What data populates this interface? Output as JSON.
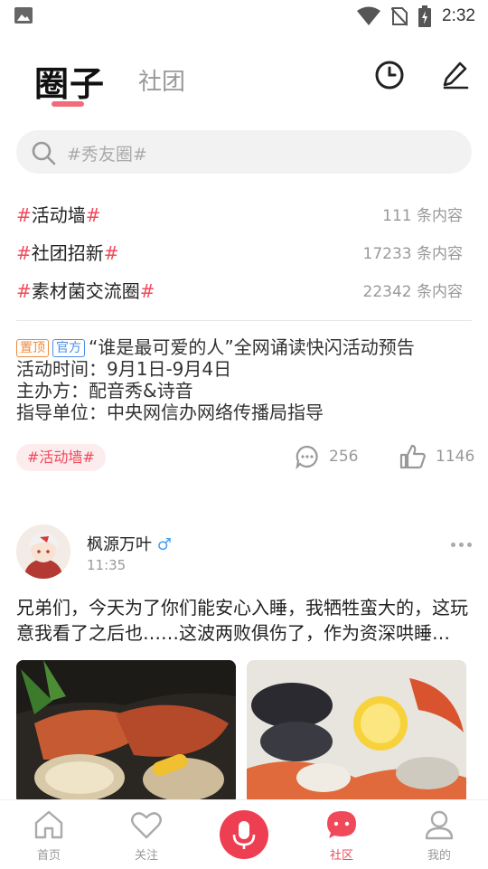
{
  "status_bar": {
    "time": "2:32"
  },
  "header": {
    "tab_active": "圈子",
    "tab_inactive": "社团"
  },
  "search": {
    "placeholder": "#秀友圈#"
  },
  "topics": [
    {
      "name": "活动墙",
      "count": "111 条内容"
    },
    {
      "name": "社团招新",
      "count": "17233 条内容"
    },
    {
      "name": "素材菌交流圈",
      "count": "22342 条内容"
    }
  ],
  "pinned_post": {
    "badge_pinned": "置顶",
    "badge_official": "官方",
    "title": "“谁是最可爱的人”全网诵读快闪活动预告",
    "line2": "活动时间：9月1日-9月4日",
    "line3": "主办方：配音秀&诗音",
    "line4": "指导单位：中央网信办网络传播局指导",
    "tag": "#活动墙#",
    "comments": "256",
    "likes": "1146"
  },
  "post": {
    "username": "枫源万叶",
    "gender_symbol": "♂",
    "time": "11:35",
    "text": "兄弟们，今天为了你们能安心入睡，我牺牲蛮大的，这玩意我看了之后也……这波两败俱伤了，作为资深哄睡…"
  },
  "bottom_nav": {
    "home": "首页",
    "follow": "关注",
    "community": "社区",
    "mine": "我的"
  },
  "colors": {
    "accent": "#f04a5a",
    "mic": "#ee3f52"
  }
}
